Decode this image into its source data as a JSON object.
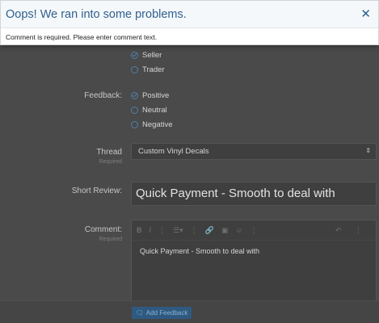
{
  "dialog": {
    "title": "Oops! We ran into some problems.",
    "message": "Comment is required. Please enter comment text.",
    "close_glyph": "✕"
  },
  "role": {
    "options": [
      "Seller",
      "Trader"
    ],
    "checked": "Seller"
  },
  "feedback": {
    "label": "Feedback:",
    "options": [
      "Positive",
      "Neutral",
      "Negative"
    ],
    "checked": "Positive"
  },
  "thread": {
    "label": "Thread",
    "required": "Required",
    "value": "Custom Vinyl Decals",
    "caret": "⇕"
  },
  "short_review": {
    "label": "Short Review:",
    "value": "Quick Payment - Smooth to deal with"
  },
  "comment": {
    "label": "Comment:",
    "required": "Required",
    "value": "Quick Payment - Smooth to deal with",
    "toolbar": [
      "B",
      "I",
      "⋮",
      "☰▾",
      "⋮",
      "🔗",
      "▣",
      "☺",
      "⋮"
    ],
    "toolbar_right": [
      "↶",
      "⋮"
    ]
  },
  "submit": {
    "label": "Add Feedback",
    "icon": "comment-icon"
  }
}
